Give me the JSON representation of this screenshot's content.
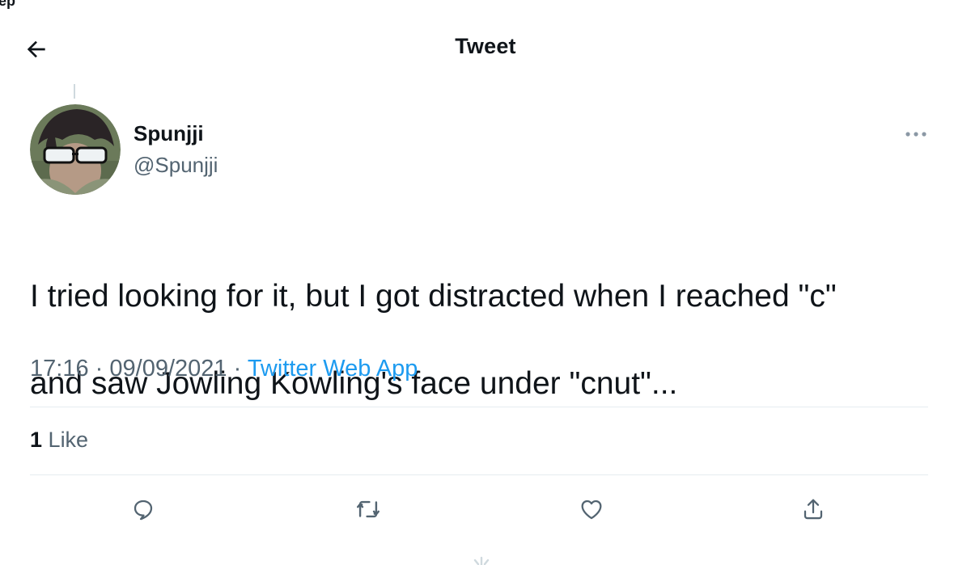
{
  "corner_fragment": "ep",
  "header": {
    "title": "Tweet",
    "back_icon": "arrow-left-icon"
  },
  "author": {
    "name": "Spunjji",
    "handle": "@Spunjji",
    "avatar_icon": "user-photo"
  },
  "more_icon": "more-horizontal-icon",
  "tweet": {
    "text_line1": "I tried looking for it, but I got distracted when I reached \"c\"",
    "text_line2": "and saw Jowling Kowling's face under \"cnut\"..."
  },
  "meta": {
    "time": "17:16",
    "separator": "·",
    "date": "09/09/2021",
    "source": "Twitter Web App"
  },
  "stats": {
    "like_count": "1",
    "like_label": "Like"
  },
  "actions": {
    "reply_icon": "reply-icon",
    "retweet_icon": "retweet-icon",
    "like_icon": "heart-icon",
    "share_icon": "share-icon"
  },
  "colors": {
    "text": "#0f1419",
    "secondary": "#536471",
    "link": "#1d9bf0",
    "divider": "#e6ecf0"
  }
}
